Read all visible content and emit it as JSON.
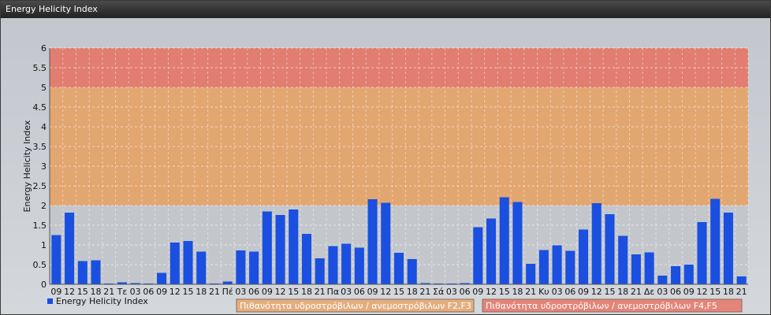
{
  "window": {
    "title": "Energy Helicity Index"
  },
  "chart_data": {
    "type": "bar",
    "ylabel": "Energy Helicity Index",
    "xlabel": "",
    "ylim": [
      0,
      6
    ],
    "yticks": [
      "0",
      "0.5",
      "1",
      "1.5",
      "2",
      "2.5",
      "3",
      "3.5",
      "4",
      "4.5",
      "5",
      "5.5",
      "6"
    ],
    "grid": true,
    "categories": [
      "09",
      "12",
      "15",
      "18",
      "21",
      "Τε",
      "03",
      "06",
      "09",
      "12",
      "15",
      "18",
      "21",
      "Πέ",
      "03",
      "06",
      "09",
      "12",
      "15",
      "18",
      "21",
      "Πα",
      "03",
      "06",
      "09",
      "12",
      "15",
      "18",
      "21",
      "Σά",
      "03",
      "06",
      "09",
      "12",
      "15",
      "18",
      "21",
      "Κυ",
      "03",
      "06",
      "09",
      "12",
      "15",
      "18",
      "21",
      "Δε",
      "03",
      "06",
      "09",
      "12",
      "15",
      "18",
      "21"
    ],
    "series": [
      {
        "name": "Energy Helicity Index",
        "color": "#1a4fe0",
        "values": [
          1.25,
          1.82,
          0.59,
          0.61,
          0.02,
          0.05,
          0.03,
          0.02,
          0.29,
          1.06,
          1.1,
          0.83,
          0.02,
          0.07,
          0.86,
          0.83,
          1.85,
          1.76,
          1.9,
          1.28,
          0.66,
          0.97,
          1.03,
          0.93,
          2.16,
          2.07,
          0.8,
          0.64,
          0.03,
          0.02,
          0.02,
          0.03,
          1.45,
          1.67,
          2.21,
          2.09,
          0.52,
          0.87,
          0.99,
          0.85,
          1.39,
          2.06,
          1.78,
          1.23,
          0.76,
          0.81,
          0.22,
          0.46,
          0.5,
          1.58,
          2.17,
          1.82,
          0.2
        ]
      }
    ],
    "bands": [
      {
        "from": 2,
        "to": 5,
        "color": "#e8a060",
        "label": "Πιθανότητα υδροστρόβιλων / ανεμοστρόβιλων F2,F3"
      },
      {
        "from": 5,
        "to": 6,
        "color": "#e87060",
        "label": "Πιθανότητα υδροστρόβιλων / ανεμοστρόβιλων F4,F5"
      }
    ],
    "legend": {
      "placement": "bottom"
    }
  }
}
